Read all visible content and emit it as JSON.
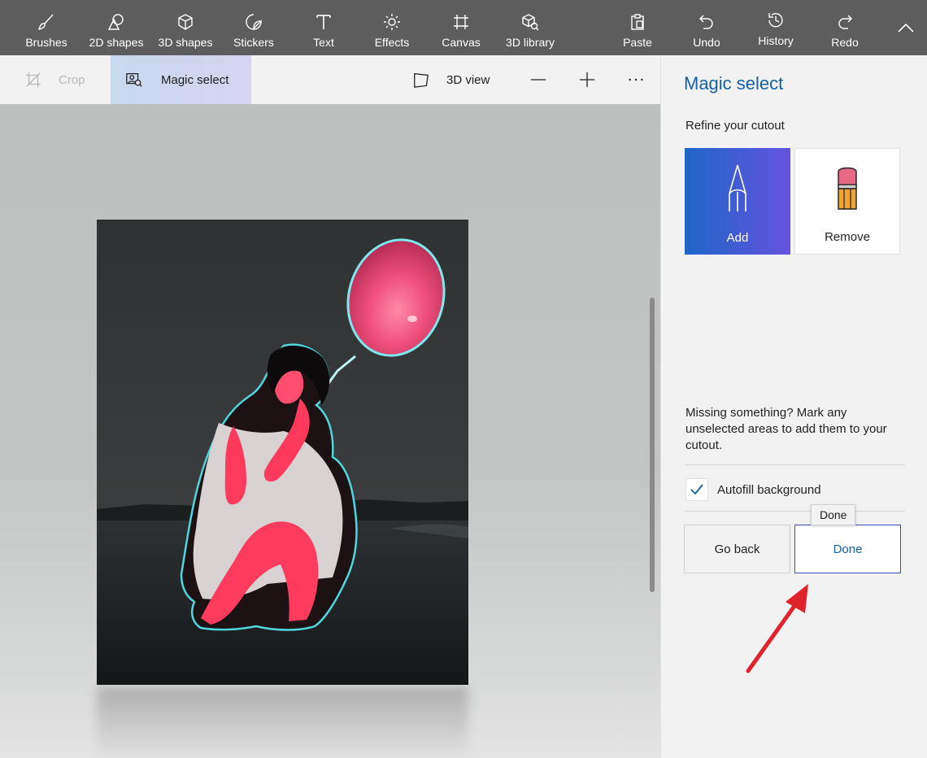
{
  "toolbar": {
    "brushes": "Brushes",
    "shapes2d": "2D shapes",
    "shapes3d": "3D shapes",
    "stickers": "Stickers",
    "text": "Text",
    "effects": "Effects",
    "canvas": "Canvas",
    "library3d": "3D library",
    "paste": "Paste",
    "undo": "Undo",
    "history": "History",
    "redo": "Redo"
  },
  "subbar": {
    "crop": "Crop",
    "magic_select": "Magic select",
    "view3d": "3D view"
  },
  "panel": {
    "title": "Magic select",
    "subtitle": "Refine your cutout",
    "add": "Add",
    "remove": "Remove",
    "hint": "Missing something? Mark any unselected areas to add them to your cutout.",
    "autofill": "Autofill background",
    "autofill_checked": true,
    "go_back": "Go back",
    "done": "Done",
    "tooltip": "Done"
  },
  "colors": {
    "toolbar_bg": "#5d5d5d",
    "accent": "#1560a8",
    "annotation": "#e0232a"
  }
}
